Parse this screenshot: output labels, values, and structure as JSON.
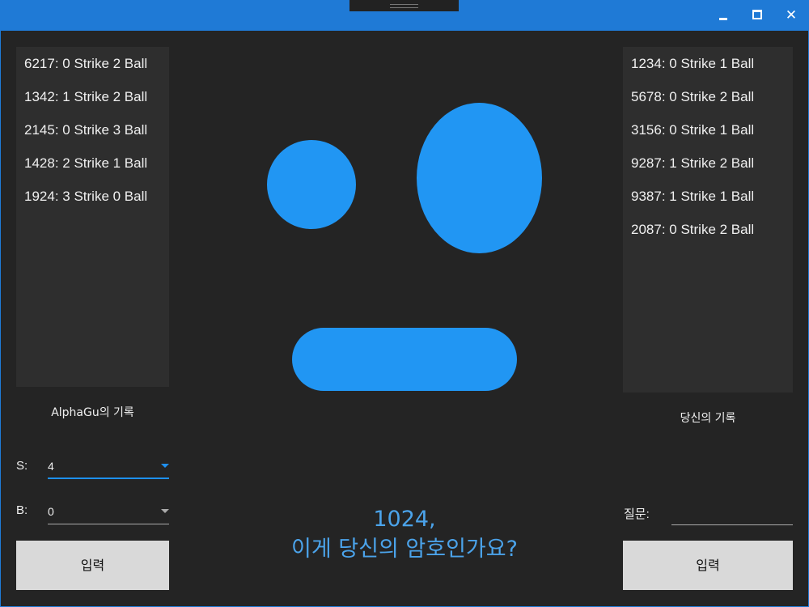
{
  "window": {
    "close_glyph": "✕"
  },
  "alphagu_panel": {
    "history": [
      "6217: 0 Strike 2 Ball",
      "1342: 1 Strike 2 Ball",
      "2145: 0 Strike 3 Ball",
      "1428: 2 Strike 1 Ball",
      "1924: 3 Strike 0 Ball"
    ],
    "caption": "AlphaGu의 기록",
    "strike_label": "S:",
    "strike_value": "4",
    "ball_label": "B:",
    "ball_value": "0",
    "submit_label": "입력"
  },
  "user_panel": {
    "history": [
      "1234: 0 Strike 1 Ball",
      "5678: 0 Strike 2 Ball",
      "3156: 0 Strike 1 Ball",
      "9287: 1 Strike 2 Ball",
      "9387: 1 Strike 1 Ball",
      "2087: 0 Strike 2 Ball"
    ],
    "caption": "당신의 기록",
    "question_label": "질문:",
    "question_value": "",
    "submit_label": "입력"
  },
  "center": {
    "guess_line": "1024,",
    "question_line": "이게 당신의 암호인가요?"
  },
  "colors": {
    "accent": "#2196f3",
    "titlebar": "#1f7ad6",
    "background": "#242424",
    "panel": "#2e2e2e",
    "message_text": "#4ba3ea"
  }
}
